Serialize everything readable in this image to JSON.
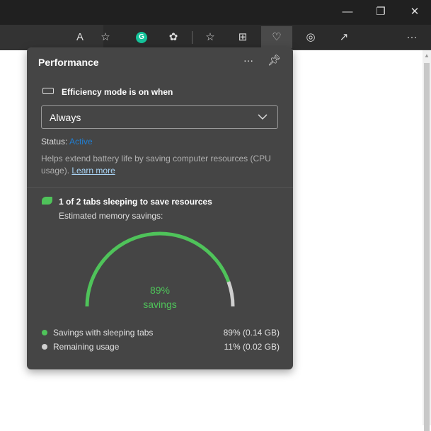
{
  "window": {
    "minimize": "—",
    "maximize": "❐",
    "close": "✕"
  },
  "toolbar": {
    "more": "···"
  },
  "panel": {
    "title": "Performance",
    "more": "···",
    "efficiency_heading": "Efficiency mode is on when",
    "dropdown_value": "Always",
    "status_label": "Status:",
    "status_value": "Active",
    "description": "Helps extend battery life by saving computer resources (CPU usage).",
    "learn_more": "Learn more",
    "sleeping_heading": "1 of 2 tabs sleeping to save resources",
    "memory_label": "Estimated memory savings:",
    "gauge": {
      "percent": 89,
      "percent_label": "89%",
      "caption": "savings"
    },
    "legend": [
      {
        "label": "Savings with sleeping tabs",
        "value": "89% (0.14 GB)",
        "color": "#4fc35a"
      },
      {
        "label": "Remaining usage",
        "value": "11% (0.02 GB)",
        "color": "#cfcfcf"
      }
    ]
  },
  "colors": {
    "accent_green": "#4fc35a",
    "status_blue": "#1f7fd4"
  }
}
